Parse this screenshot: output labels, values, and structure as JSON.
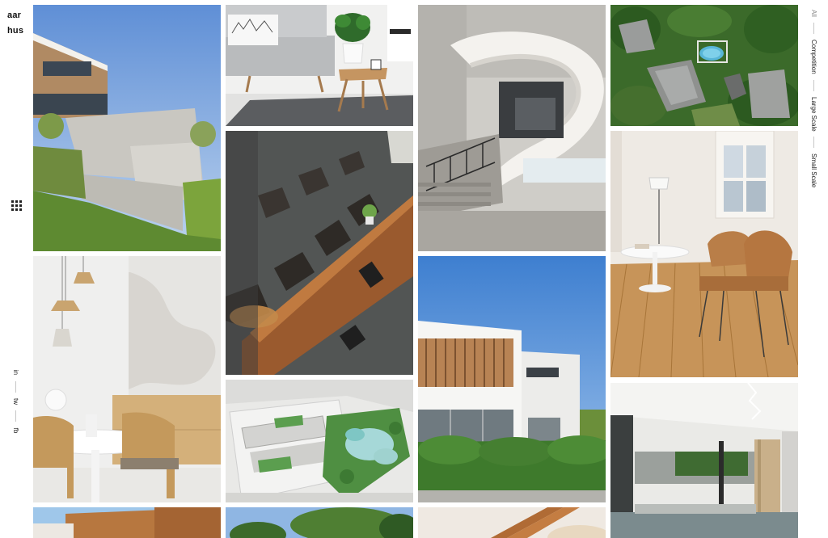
{
  "brand": {
    "line1": "aar",
    "line2": "hus"
  },
  "filters": [
    {
      "label": "All",
      "active": true
    },
    {
      "label": "Competition",
      "active": false
    },
    {
      "label": "Large Scale",
      "active": false
    },
    {
      "label": "Small Scale",
      "active": false
    }
  ],
  "social": {
    "in": "in",
    "tw": "tw",
    "fb": "fb"
  },
  "menu_icon": "grid-dots-icon",
  "colors": {
    "background": "#ffffff",
    "text": "#111111",
    "separator": "#c7c7c7"
  }
}
